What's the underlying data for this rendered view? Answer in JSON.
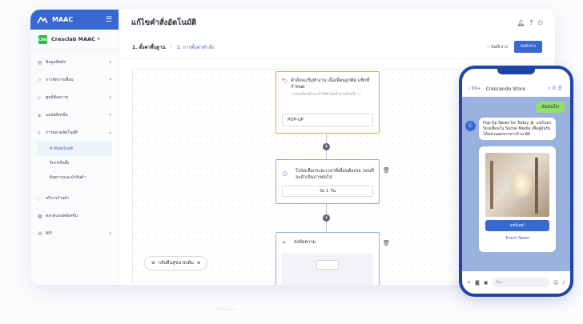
{
  "app": {
    "brand": "MAAC",
    "account": "Cresclab MAAC",
    "line_badge": "LINE"
  },
  "sidebar": {
    "items": [
      {
        "icon": "database-icon",
        "glyph": "▤",
        "label": "ข้อมูลลีดดัก",
        "chevron": "▾"
      },
      {
        "icon": "people-icon",
        "glyph": "⚇",
        "label": "การจัดการเพื่อน",
        "chevron": "▾"
      },
      {
        "icon": "broadcast-icon",
        "glyph": "▷",
        "label": "ศูนย์ข้อความ",
        "chevron": "▾"
      },
      {
        "icon": "tag-icon",
        "glyph": "◈",
        "label": "แอปพลิเคชั่น",
        "chevron": "▾"
      },
      {
        "icon": "automation-icon",
        "glyph": "ϟ",
        "label": "การตลาดอัตโนมัติ",
        "chevron": "▴"
      }
    ],
    "subitems": [
      "คำสั่งอัตโนมัติ",
      "รีมาร์เก็ตติ้ง",
      "ข้อความแนะนำสินค้า"
    ],
    "bottom_items": [
      {
        "icon": "shop-icon",
        "glyph": "◌",
        "label": "บริการร้านค้า",
        "chevron": ""
      },
      {
        "icon": "report-icon",
        "glyph": "▦",
        "label": "ตลาดแอปพลิเคชั่น",
        "chevron": ""
      },
      {
        "icon": "api-icon",
        "glyph": "⌘",
        "label": "API",
        "chevron": "▾"
      }
    ]
  },
  "header": {
    "title": "แก้ไขคำสั่งอัตโนมัติ",
    "icons": [
      "bell-icon",
      "help-icon",
      "user-icon"
    ]
  },
  "steps": {
    "step1": "1. ตั้งค่าพื้นฐาน",
    "separator": "›",
    "step2": "2. การตั้งค่าคำสั่ง",
    "saved": "บันทึกร่าง",
    "save_button": "บันทึกร่าง"
  },
  "flow": {
    "trigger_title": "คำสั่งจะเริ่มทำงาน เมื่อเพื่อนถูกติด แท็กที่กำหนด",
    "trigger_sub": "การกดติดแท็กจะทำให้คำสั่งทำงานอีกครั้ง ⓘ",
    "trigger_value": "POP-UP",
    "delay_title": "โปรดเลือกระยะเวลาที่เพื่อนต้องรอ ก่อนที่จะดำเนินการต่อไป",
    "delay_value": "รอ 1 วัน",
    "message_title": "ส่งข้อความ",
    "zoom_label": "กลับคืนสู่ขนาดเดิม"
  },
  "phone": {
    "back": "‹ 99+",
    "store": "Crescendo Store",
    "me_bubble": "ฉันสนใจ!",
    "avatar": "C",
    "news_text": "Pop-Up News for Today 🎉 แชร์นอกร้อนเพื่อนใน Social Media เพื่อสู่ลุ้นรับโค้ดส่วนลดจากทางร้าน 🎟",
    "button": "แชร์เลย!",
    "link": "Event News",
    "input_placeholder": "Aa"
  },
  "colors": {
    "accent": "#3a68d3",
    "line_green": "#2fb545",
    "trigger_border": "#f0a540",
    "delay_border": "#b497e0",
    "msg_border": "#8fb1ec"
  }
}
